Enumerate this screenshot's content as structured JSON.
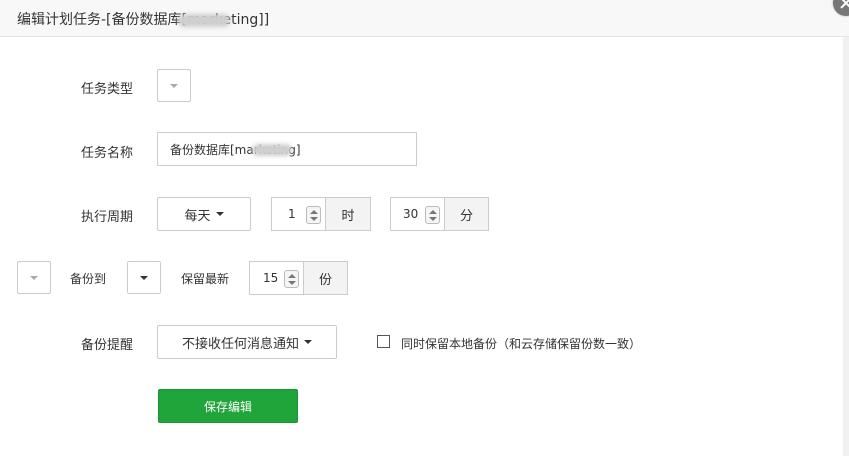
{
  "dialog": {
    "title": "编辑计划任务-[备份数据库[marketing]]"
  },
  "form": {
    "task_type": {
      "label": "任务类型"
    },
    "task_name": {
      "label": "任务名称",
      "value": "备份数据库[marketing]"
    },
    "period": {
      "label": "执行周期",
      "frequency": "每天",
      "hour": {
        "value": "1",
        "unit": "时"
      },
      "minute": {
        "value": "30",
        "unit": "分"
      }
    },
    "backup": {
      "label": "备份到",
      "keep_label": "保留最新",
      "keep": {
        "value": "15",
        "unit": "份"
      }
    },
    "notify": {
      "label": "备份提醒",
      "value": "不接收任何消息通知",
      "local_keep_label": "同时保留本地备份（和云存储保留份数一致）",
      "local_keep_checked": false
    },
    "save_label": "保存编辑"
  },
  "colors": {
    "primary": "#20a53a",
    "titlebar_bg": "#f8f8f8",
    "border": "#cccccc"
  }
}
